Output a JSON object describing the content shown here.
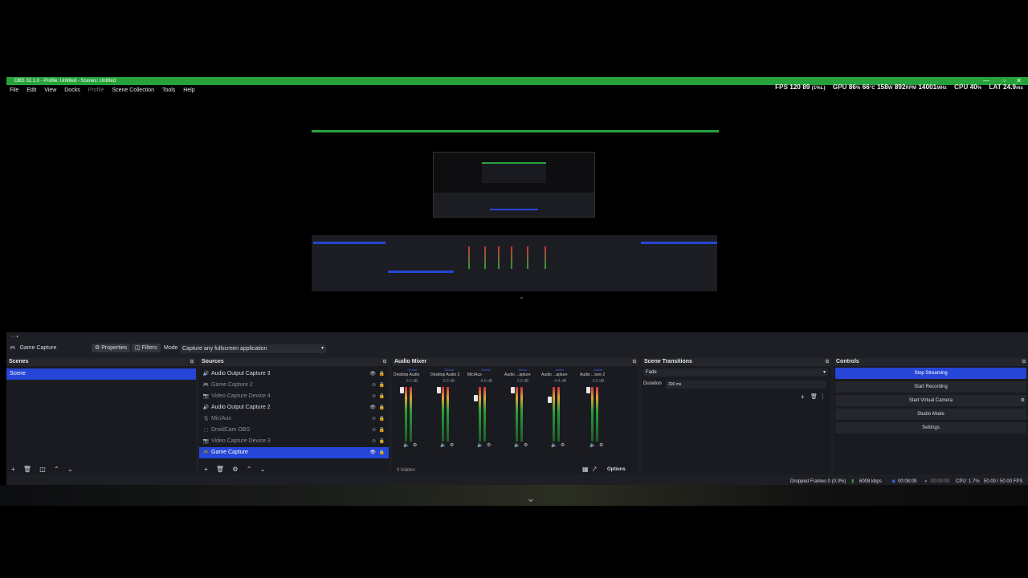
{
  "window": {
    "title": "OBS 32.1.0 - Profile: Untitled - Scenes: Untitled"
  },
  "menu": [
    "File",
    "Edit",
    "View",
    "Docks",
    "Profile",
    "Scene Collection",
    "Tools",
    "Help"
  ],
  "overlay_stats": {
    "fps_label": "FPS",
    "fps_value": "120",
    "fps_low": "89",
    "fps_low_pct": "(1%L)",
    "gpu_label": "GPU",
    "gpu_load": "86",
    "gpu_temp": "66",
    "gpu_power": "158",
    "gpu_rpm": "892",
    "gpu_clock": "14001",
    "cpu_label": "CPU",
    "cpu_value": "40",
    "lat_label": "LAT",
    "lat_value": "24.9"
  },
  "context_bar": {
    "source_name": "Game Capture",
    "properties_label": "Properties",
    "filters_label": "Filters",
    "mode_label": "Mode",
    "mode_value": "Capture any fullscreen application"
  },
  "scenes": {
    "title": "Scenes",
    "items": [
      "Scene"
    ]
  },
  "sources": {
    "title": "Sources",
    "items": [
      {
        "name": "Audio Output Capture 3",
        "active": true,
        "icon": "speaker-icon"
      },
      {
        "name": "Game Capture 2",
        "active": false,
        "icon": "gamepad-icon"
      },
      {
        "name": "Video Capture Device 4",
        "active": false,
        "icon": "camera-icon"
      },
      {
        "name": "Audio Output Capture 2",
        "active": true,
        "icon": "speaker-icon"
      },
      {
        "name": "Mic/Aux",
        "active": false,
        "icon": "mic-icon"
      },
      {
        "name": "DroidCam OBS",
        "active": false,
        "icon": "droidcam-icon"
      },
      {
        "name": "Video Capture Device 3",
        "active": false,
        "icon": "camera-icon"
      },
      {
        "name": "Game Capture",
        "active": true,
        "icon": "gamepad-icon",
        "selected": true
      }
    ]
  },
  "audio_mixer": {
    "title": "Audio Mixer",
    "hidden_label": "0 hidden",
    "options_label": "Options",
    "channels": [
      {
        "name": "Desktop Audio",
        "status": "Global",
        "db": "0.0 dB"
      },
      {
        "name": "Desktop Audio 2",
        "status": "Global",
        "db": "0.0 dB"
      },
      {
        "name": "Mic/Aux",
        "status": "Global",
        "db": "-4.0 dB"
      },
      {
        "name": "Audio ...apture",
        "status": "Active",
        "db": "0.0 dB"
      },
      {
        "name": "Audio ...apture",
        "status": "Active",
        "db": "-4.4 dB"
      },
      {
        "name": "Audio ...ture 2",
        "status": "Active",
        "db": "0.0 dB"
      }
    ]
  },
  "transitions": {
    "title": "Scene Transitions",
    "value": "Fade",
    "duration_label": "Duration",
    "duration_value": "300 ms"
  },
  "controls": {
    "title": "Controls",
    "stop_streaming": "Stop Streaming",
    "start_recording": "Start Recording",
    "start_virtual_camera": "Start Virtual Camera",
    "studio_mode": "Studio Mode",
    "settings": "Settings"
  },
  "status_bar": {
    "dropped_frames": "Dropped Frames 0 (0.0%)",
    "bitrate": "6008 kbps",
    "stream_time": "00:08:09",
    "rec_time": "00:00:00",
    "cpu": "CPU: 1.7%",
    "fps": "50.00 / 50.00 FPS"
  },
  "colors": {
    "accent": "#2546d6",
    "titlebar": "#27a23b",
    "bg": "#1e1f24"
  }
}
